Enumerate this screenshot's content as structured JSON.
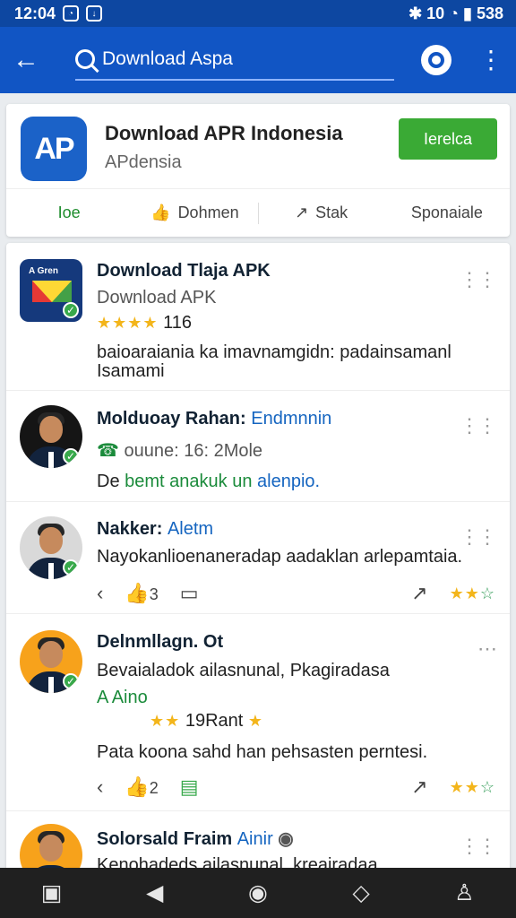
{
  "status": {
    "time": "12:04",
    "right": "✱ 10 ◔ ▮ 538"
  },
  "appbar": {
    "query": "Download Aspa"
  },
  "hero": {
    "title": "Download APR Indonesia",
    "subtitle": "APdensia",
    "install_label": "Ierelca",
    "actions": [
      "Ioe",
      "Dohmen",
      "Stak",
      "Sponaiale"
    ]
  },
  "feed": {
    "items": [
      {
        "title": "Download Tlaja APK",
        "subtitle": "Download APK",
        "rating_text": "116",
        "body": "baioaraiania ka imavnamgidn: padainsamanl Isamami"
      },
      {
        "title": "Molduoay Rahan:",
        "accent": "Endmnnin",
        "meta": "ouune: 16: 2Mole",
        "body_prefix": "De",
        "body_green": "bemt anakuk un",
        "body_blue": "alenpio."
      },
      {
        "title": "Nakker:",
        "accent": "Aletm",
        "body": "Nayokanlioenaneradap aadaklan arlepamtaia.",
        "like_count": "3"
      },
      {
        "title": "Delnmllagn. Ot",
        "subtitle": "Bevaialadok ailasnunal, Pkagiradasa",
        "green_label": "A Aino",
        "rating_text": "19Rant",
        "body": "Pata koona sahd han pehsasten perntesi.",
        "like_count": "2"
      },
      {
        "title": "Solorsald Fraim",
        "accent": "Ainir",
        "body": "Kenohadeds ailasnunal. kreairadaa."
      }
    ]
  },
  "colors": {
    "primary": "#1155c4",
    "status": "#0d47a1",
    "green": "#3aaa35",
    "gold": "#f3b51b"
  }
}
